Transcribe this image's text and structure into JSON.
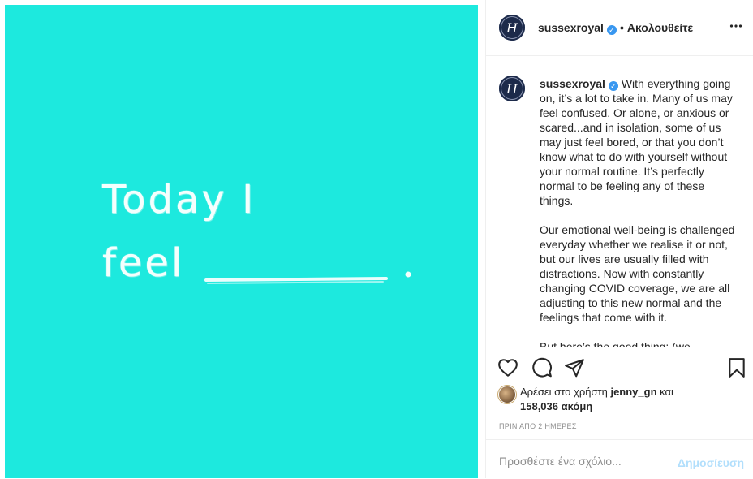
{
  "post": {
    "image": {
      "background": "#1de9de",
      "line1": "Today I",
      "line2": "feel"
    }
  },
  "header": {
    "avatar_letter": "H",
    "username": "sussexroyal",
    "separator": "•",
    "follow_status": "Ακολουθείτε",
    "more_icon": "more-horizontal-icon"
  },
  "caption": {
    "username": "sussexroyal",
    "text": " With everything going on, it’s a lot to take in. Many of us may feel confused. Or alone, or anxious or scared...and in isolation, some of us may just feel bored, or that you don’t know what to do with yourself without your normal routine. It’s perfectly normal to be feeling any of these things.\n\nOur emotional well-being is challenged everyday whether we realise it or not, but our lives are usually filled with distractions. Now with constantly changing COVID coverage, we are all adjusting to this new normal and the feelings that come with it.\n\nBut here’s the good thing: (we"
  },
  "actions": {
    "icons": [
      "heart-icon",
      "comment-icon",
      "share-icon",
      "bookmark-icon"
    ]
  },
  "likes": {
    "prefix": "Αρέσει στο χρήστη ",
    "liker": "jenny_gn",
    "suffix": " και",
    "count_text": "158,036 ακόμη"
  },
  "timestamp": "ΠΡΙΝ ΑΠΟ 2 ΗΜΕΡΕΣ",
  "add_comment": {
    "placeholder": "Προσθέστε ένα σχόλιο...",
    "post_label": "Δημοσίευση"
  },
  "colors": {
    "accent": "#3897f0",
    "post_disabled": "#b2dffc",
    "muted": "#8e8e8e"
  }
}
